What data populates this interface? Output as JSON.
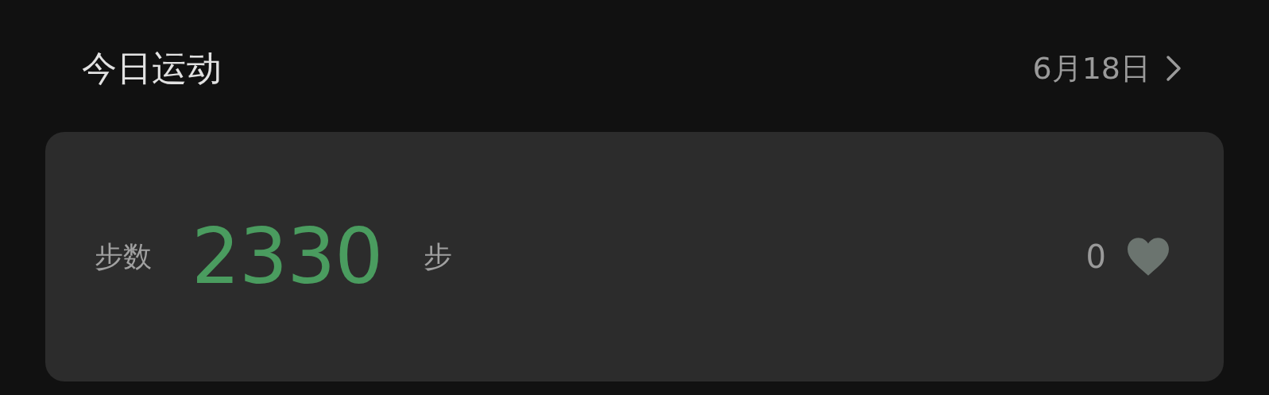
{
  "header": {
    "title": "今日运动",
    "date": "6月18日"
  },
  "card": {
    "label": "步数",
    "value": "2330",
    "unit": "步",
    "likes": "0"
  }
}
